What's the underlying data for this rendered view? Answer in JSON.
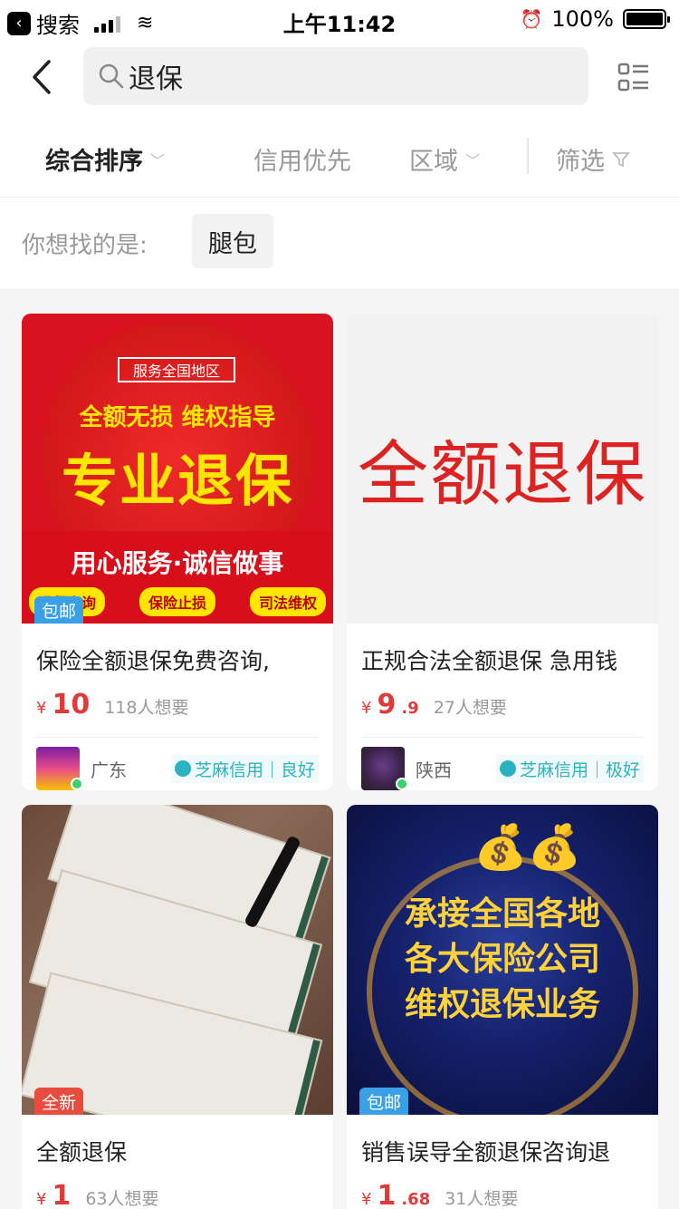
{
  "status_bar": {
    "back_app": "搜索",
    "time": "上午11:42",
    "battery_text": "100%"
  },
  "search": {
    "query": "退保"
  },
  "filters": {
    "comprehensive": "综合排序",
    "credit_first": "信用优先",
    "region": "区域",
    "filter": "筛选"
  },
  "suggestion": {
    "label": "你想找的是:",
    "chip": "腿包"
  },
  "products": [
    {
      "image_text": {
        "top_box": "服务全国地区",
        "line1": "全额无损 维权指导",
        "line2": "专业退保",
        "line3": "用心服务·诚信做事",
        "pills": [
          "退保咨询",
          "保险止损",
          "司法维权"
        ]
      },
      "tag": "包邮",
      "title": "保险全额退保免费咨询,",
      "price_symbol": "¥",
      "price_int": "10",
      "price_dec": "",
      "want": "118人想要",
      "region": "广东",
      "credit": "芝麻信用｜良好"
    },
    {
      "image_text": {
        "main": "全额退保"
      },
      "tag": "",
      "title": "正规合法全额退保 急用钱",
      "price_symbol": "¥",
      "price_int": "9",
      "price_dec": ".9",
      "want": "27人想要",
      "region": "陕西",
      "credit": "芝麻信用｜极好"
    },
    {
      "tag": "全新",
      "title": "全额退保",
      "price_symbol": "¥",
      "price_int": "1",
      "price_dec": "",
      "want": "63人想要"
    },
    {
      "image_text": {
        "lines": [
          "承接全国各地",
          "各大保险公司",
          "维权退保业务"
        ]
      },
      "tag": "包邮",
      "title": "销售误导全额退保咨询退",
      "price_symbol": "¥",
      "price_int": "1",
      "price_dec": ".68",
      "want": "31人想要"
    }
  ]
}
